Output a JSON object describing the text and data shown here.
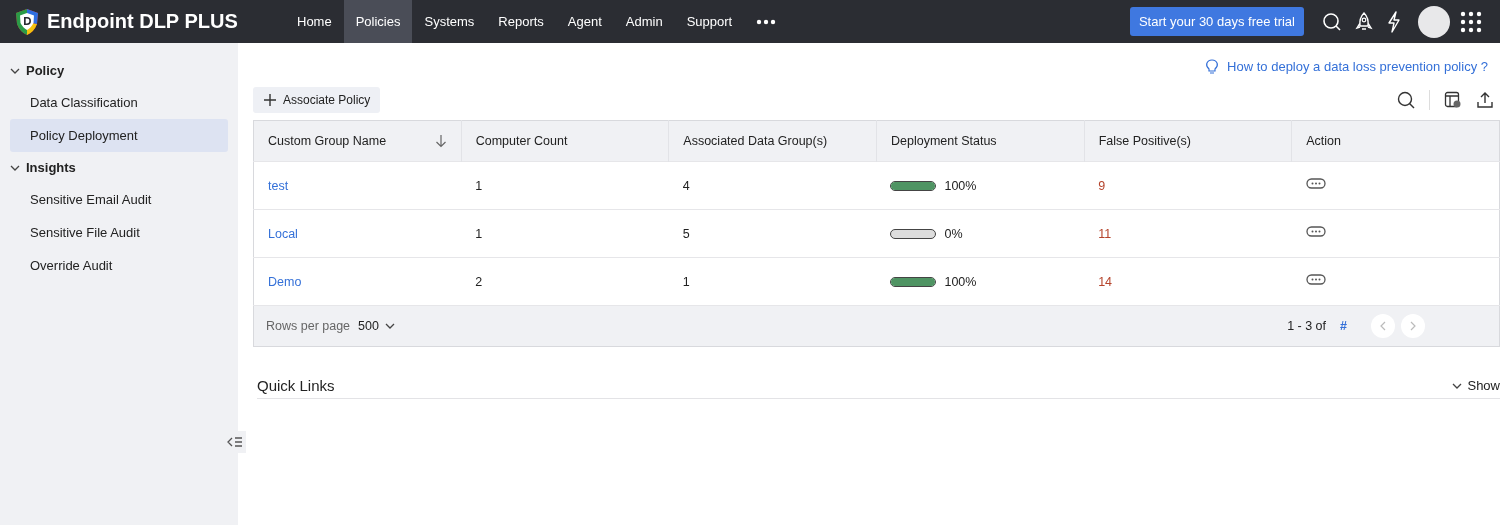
{
  "app": {
    "title": "Endpoint DLP PLUS"
  },
  "nav": [
    {
      "label": "Home",
      "selected": false
    },
    {
      "label": "Policies",
      "selected": true
    },
    {
      "label": "Systems",
      "selected": false
    },
    {
      "label": "Reports",
      "selected": false
    },
    {
      "label": "Agent",
      "selected": false
    },
    {
      "label": "Admin",
      "selected": false
    },
    {
      "label": "Support",
      "selected": false
    }
  ],
  "trial_button": "Start your 30 days free trial",
  "sidebar": [
    {
      "label": "Policy",
      "expanded": true,
      "items": [
        {
          "label": "Data Classification",
          "selected": false
        },
        {
          "label": "Policy Deployment",
          "selected": true
        }
      ]
    },
    {
      "label": "Insights",
      "expanded": true,
      "items": [
        {
          "label": "Sensitive Email Audit",
          "selected": false
        },
        {
          "label": "Sensitive File Audit",
          "selected": false
        },
        {
          "label": "Override Audit",
          "selected": false
        }
      ]
    }
  ],
  "help_link": "How to deploy a data loss prevention policy ?",
  "associate_button": "Associate Policy",
  "table": {
    "columns": [
      {
        "label": "Custom Group Name",
        "sorted": true
      },
      {
        "label": "Computer Count",
        "sorted": false
      },
      {
        "label": "Associated Data Group(s)",
        "sorted": false
      },
      {
        "label": "Deployment Status",
        "sorted": false
      },
      {
        "label": "False Positive(s)",
        "sorted": false
      },
      {
        "label": "Action",
        "sorted": false
      }
    ],
    "rows": [
      {
        "name": "test",
        "computers": "1",
        "data_groups": "4",
        "level": 1,
        "status": "100%",
        "false_positives": "9"
      },
      {
        "name": "Local",
        "computers": "1",
        "data_groups": "5",
        "level": 0,
        "status": "0%",
        "false_positives": "11"
      },
      {
        "name": "Demo",
        "computers": "2",
        "data_groups": "1",
        "level": 1,
        "status": "100%",
        "false_positives": "14"
      }
    ],
    "footer": {
      "rows_per_page_label": "Rows per page",
      "rows_per_page": "500",
      "range": "1 - 3 of",
      "total": "#"
    }
  },
  "quick_links": {
    "title": "Quick Links",
    "toggle": "Show"
  }
}
